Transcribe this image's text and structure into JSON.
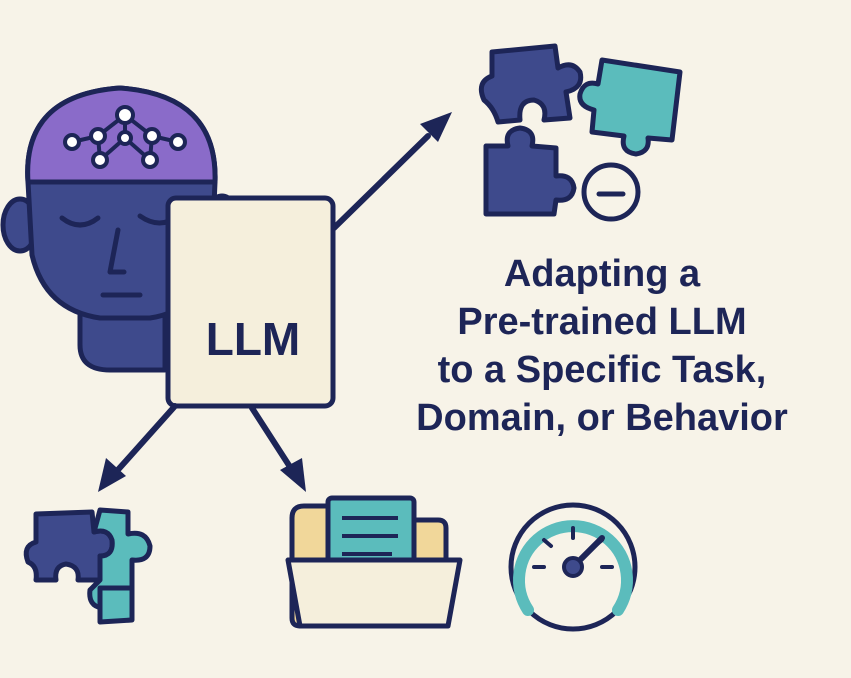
{
  "diagram": {
    "center_label": "LLM",
    "headline_lines": [
      "Adapting a",
      "Pre-trained LLM",
      "to a Specific Task,",
      "Domain, or Behavior"
    ],
    "icons": [
      "brain-head-icon",
      "network-nodes-icon",
      "document-card-icon",
      "puzzle-pieces-separated-icon",
      "minus-circle-icon",
      "puzzle-pieces-joined-icon",
      "folder-document-icon",
      "speedometer-gauge-icon"
    ],
    "colors": {
      "background": "#f7f3e8",
      "navy": "#1d2557",
      "head_fill": "#3e4a8c",
      "brain_purple": "#8a6bc9",
      "teal": "#5bbcbc",
      "card_fill": "#f5efdc",
      "folder_yellow": "#f1d79a"
    }
  }
}
